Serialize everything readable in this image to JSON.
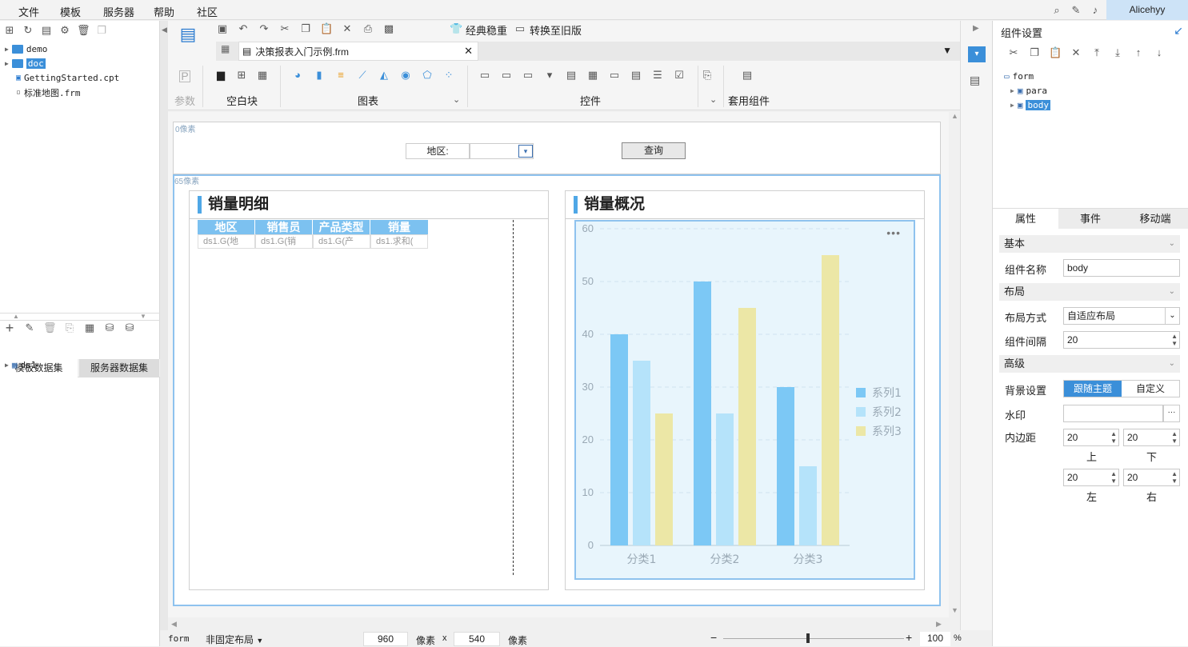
{
  "menu": {
    "items": [
      "文件",
      "模板",
      "服务器",
      "帮助",
      "社区"
    ],
    "user": "Alicehyy"
  },
  "left_tree": {
    "items": [
      {
        "label": "demo",
        "type": "folder"
      },
      {
        "label": "doc",
        "type": "folder",
        "selected": true
      },
      {
        "label": "GettingStarted.cpt",
        "type": "cpt"
      },
      {
        "label": "标准地图.frm",
        "type": "frm"
      }
    ],
    "dataset_tabs": [
      "模板数据集",
      "服务器数据集"
    ],
    "datasets": [
      "ds1"
    ]
  },
  "toolbar": {
    "classic_label": "经典稳重",
    "convert_label": "转换至旧版",
    "doc_tab": "决策报表入门示例.frm",
    "groups": [
      "参数",
      "空白块",
      "图表",
      "控件",
      "套用组件"
    ]
  },
  "canvas": {
    "para_label": "0像素",
    "body_label": "65像素",
    "region_label": "地区:",
    "query_button": "查询"
  },
  "table_card": {
    "title": "销量明细",
    "headers": [
      "地区",
      "销售员",
      "产品类型",
      "销量"
    ],
    "cells": [
      "ds1.G(地",
      "ds1.G(销",
      "ds1.G(产",
      "ds1.求和("
    ]
  },
  "chart_data": {
    "type": "bar",
    "title": "销量概况",
    "categories": [
      "分类1",
      "分类2",
      "分类3"
    ],
    "series": [
      {
        "name": "系列1",
        "values": [
          40,
          50,
          30
        ],
        "color": "#7cc8f5"
      },
      {
        "name": "系列2",
        "values": [
          35,
          25,
          15
        ],
        "color": "#b5e3fa"
      },
      {
        "name": "系列3",
        "values": [
          25,
          45,
          55
        ],
        "color": "#ece7a6"
      }
    ],
    "y_ticks": [
      "0",
      "10",
      "20",
      "30",
      "40",
      "50",
      "60"
    ],
    "ylim": [
      0,
      60
    ],
    "grid": true,
    "legend": "right"
  },
  "right_panel": {
    "title": "组件设置",
    "tree": [
      "form",
      "para",
      "body"
    ],
    "tabs": [
      "属性",
      "事件",
      "移动端"
    ],
    "sections": {
      "basic": "基本",
      "layout": "布局",
      "advanced": "高级"
    },
    "component_name_label": "组件名称",
    "component_name": "body",
    "layout_mode_label": "布局方式",
    "layout_mode": "自适应布局",
    "gap_label": "组件间隔",
    "gap": "20",
    "bg_label": "背景设置",
    "bg_options": [
      "跟随主题",
      "自定义"
    ],
    "watermark_label": "水印",
    "padding_label": "内边距",
    "padding": {
      "top": "20",
      "bottom": "20",
      "left": "20",
      "right": "20"
    },
    "padding_names": {
      "top": "上",
      "bottom": "下",
      "left": "左",
      "right": "右"
    }
  },
  "status": {
    "form": "form",
    "layout": "非固定布局",
    "width": "960",
    "height": "540",
    "unit": "像素",
    "times": "x",
    "zoom": "100",
    "pct": "%"
  }
}
